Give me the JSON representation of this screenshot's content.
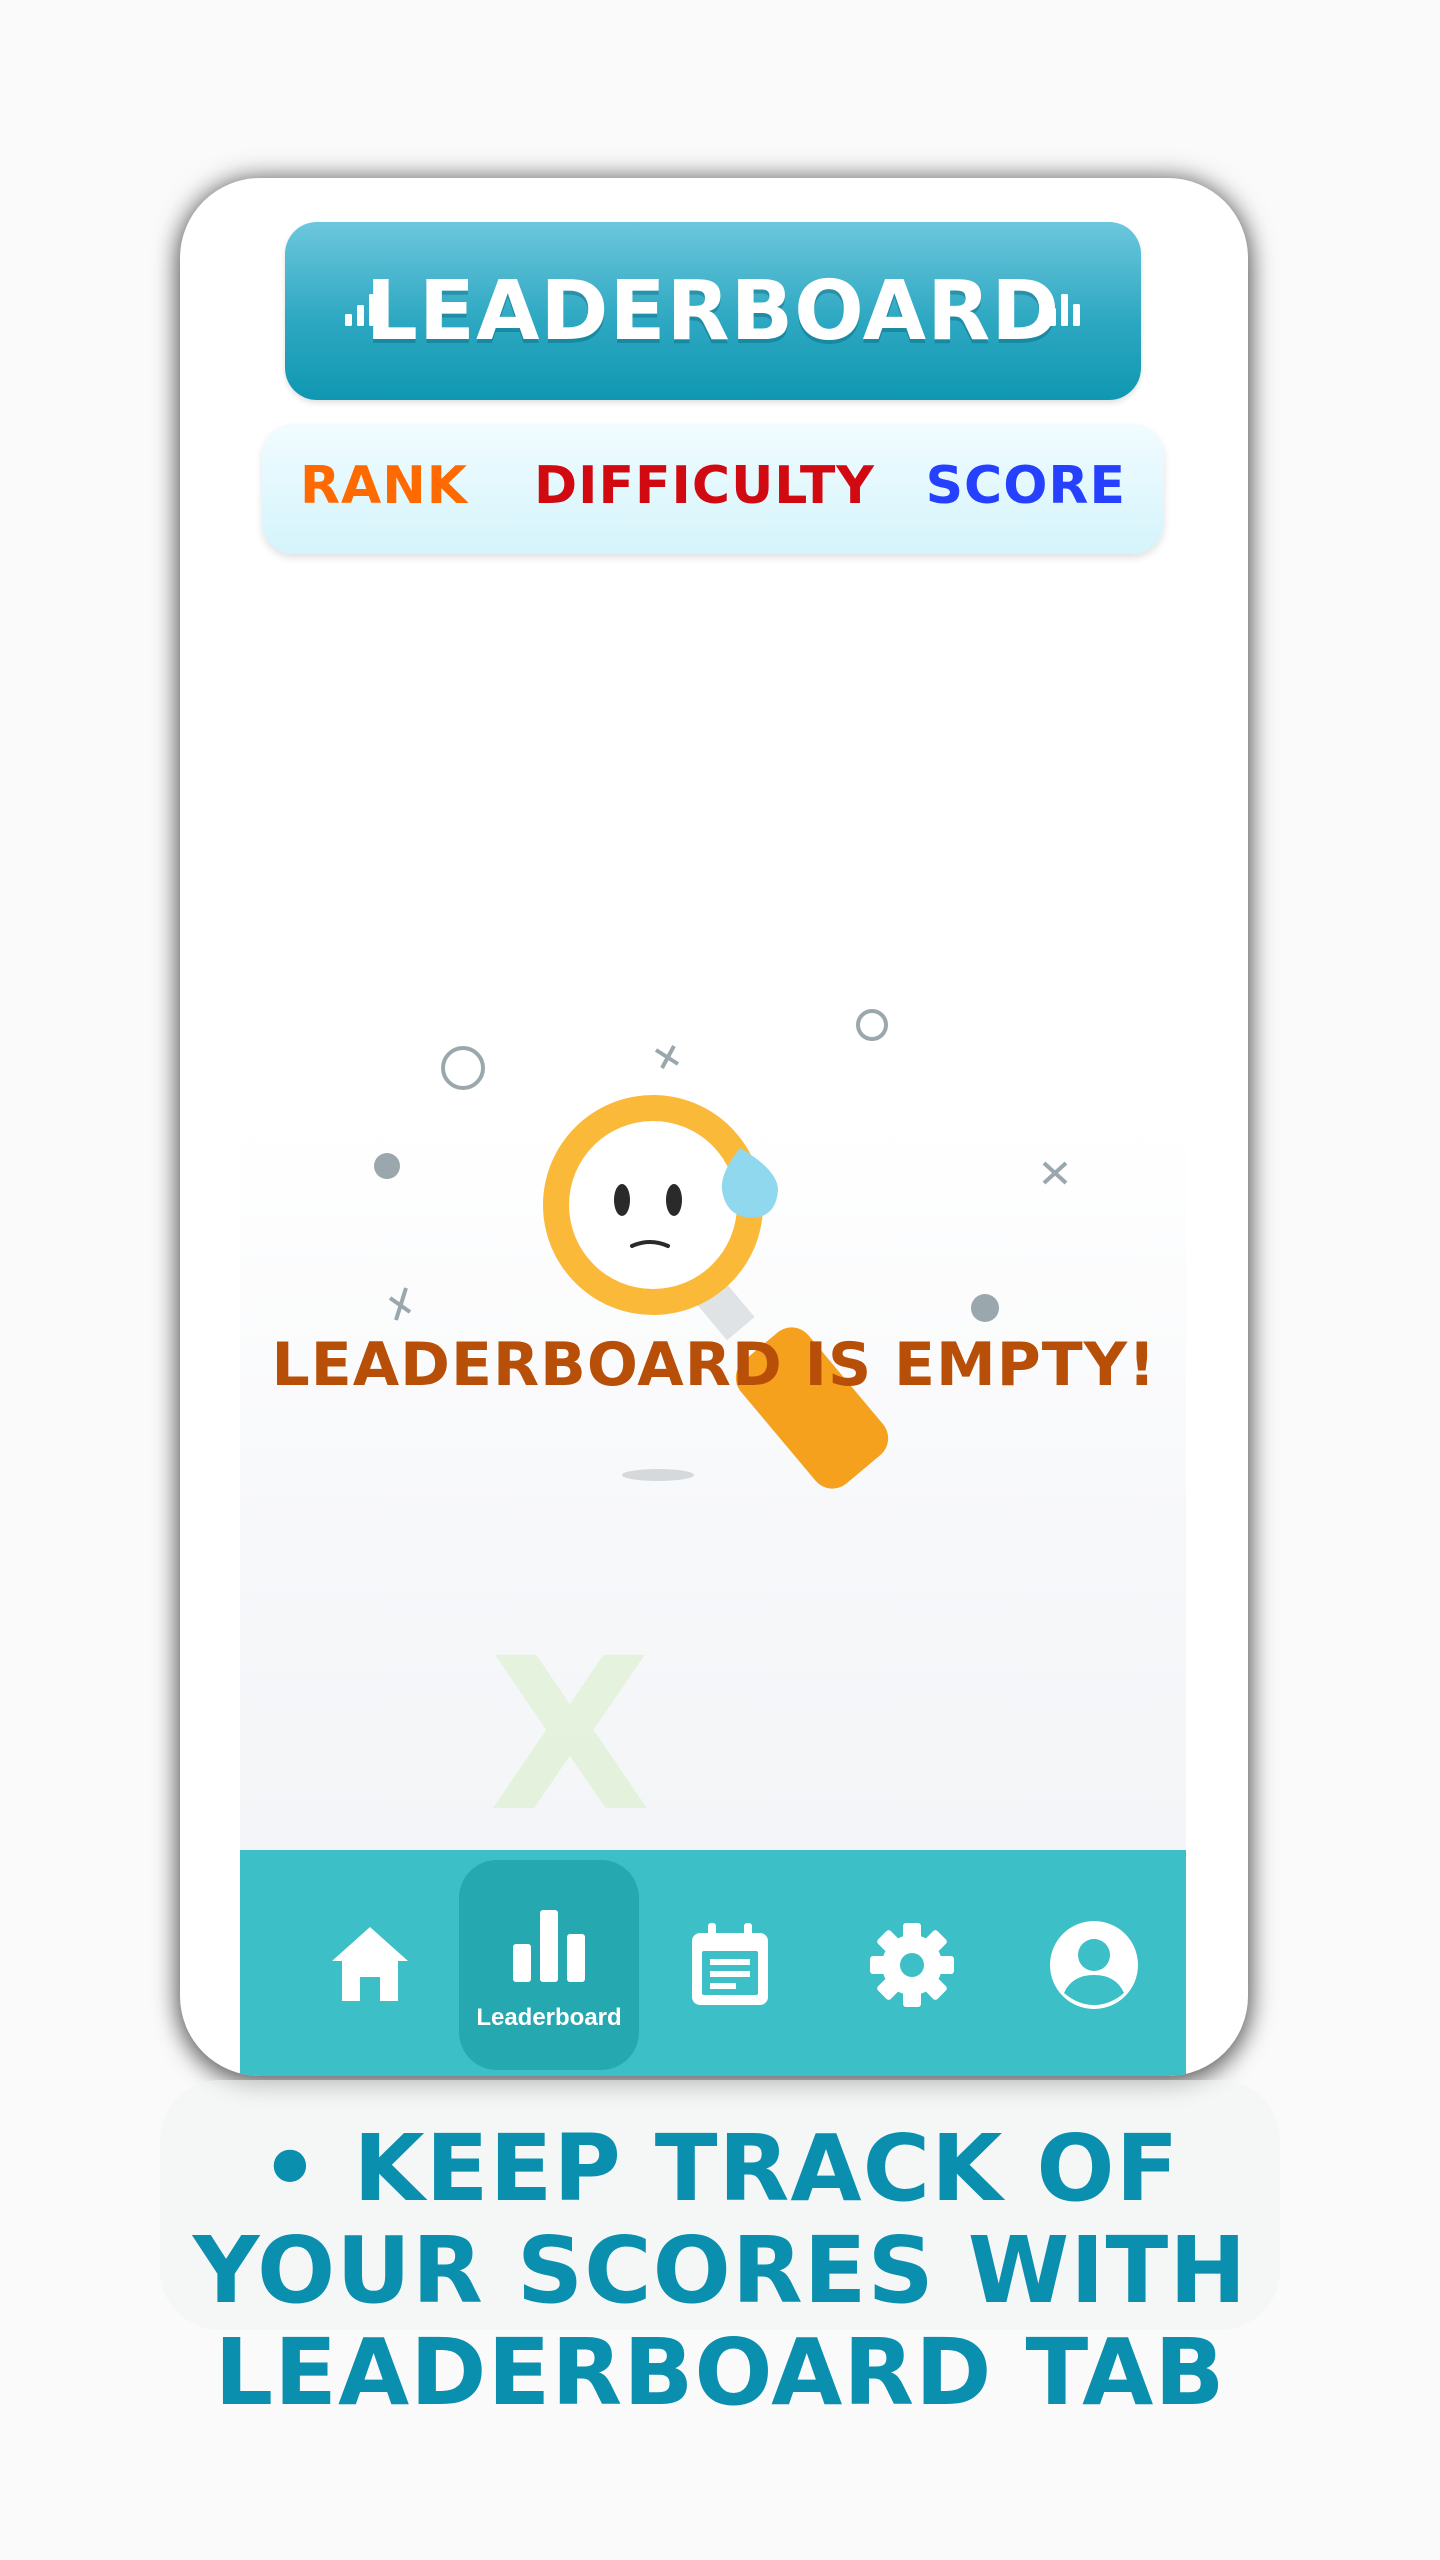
{
  "header": {
    "title": "LEADERBOARD",
    "title_icon": "bar-chart-icon"
  },
  "columns": {
    "rank": "RANK",
    "difficulty": "DIFFICULTY",
    "score": "SCORE"
  },
  "empty_state": {
    "message": "LEADERBOARD IS EMPTY!",
    "illustration": "sad-magnifying-glass"
  },
  "bottom_nav": {
    "items": [
      {
        "icon": "home-icon",
        "label": ""
      },
      {
        "icon": "bar-chart-icon",
        "label": "Leaderboard",
        "active": true
      },
      {
        "icon": "calendar-icon",
        "label": ""
      },
      {
        "icon": "settings-icon",
        "label": ""
      },
      {
        "icon": "profile-icon",
        "label": ""
      }
    ]
  },
  "caption": {
    "line1": "• KEEP TRACK OF",
    "line2": "YOUR SCORES WITH",
    "line3": "LEADERBOARD TAB"
  },
  "colors": {
    "banner": "#2ea8c2",
    "rank": "#ff6a00",
    "difficulty": "#d10a12",
    "score": "#2540ff",
    "empty_text": "#b84f08",
    "nav": "#3cbfc6",
    "caption": "#0b8fae"
  }
}
